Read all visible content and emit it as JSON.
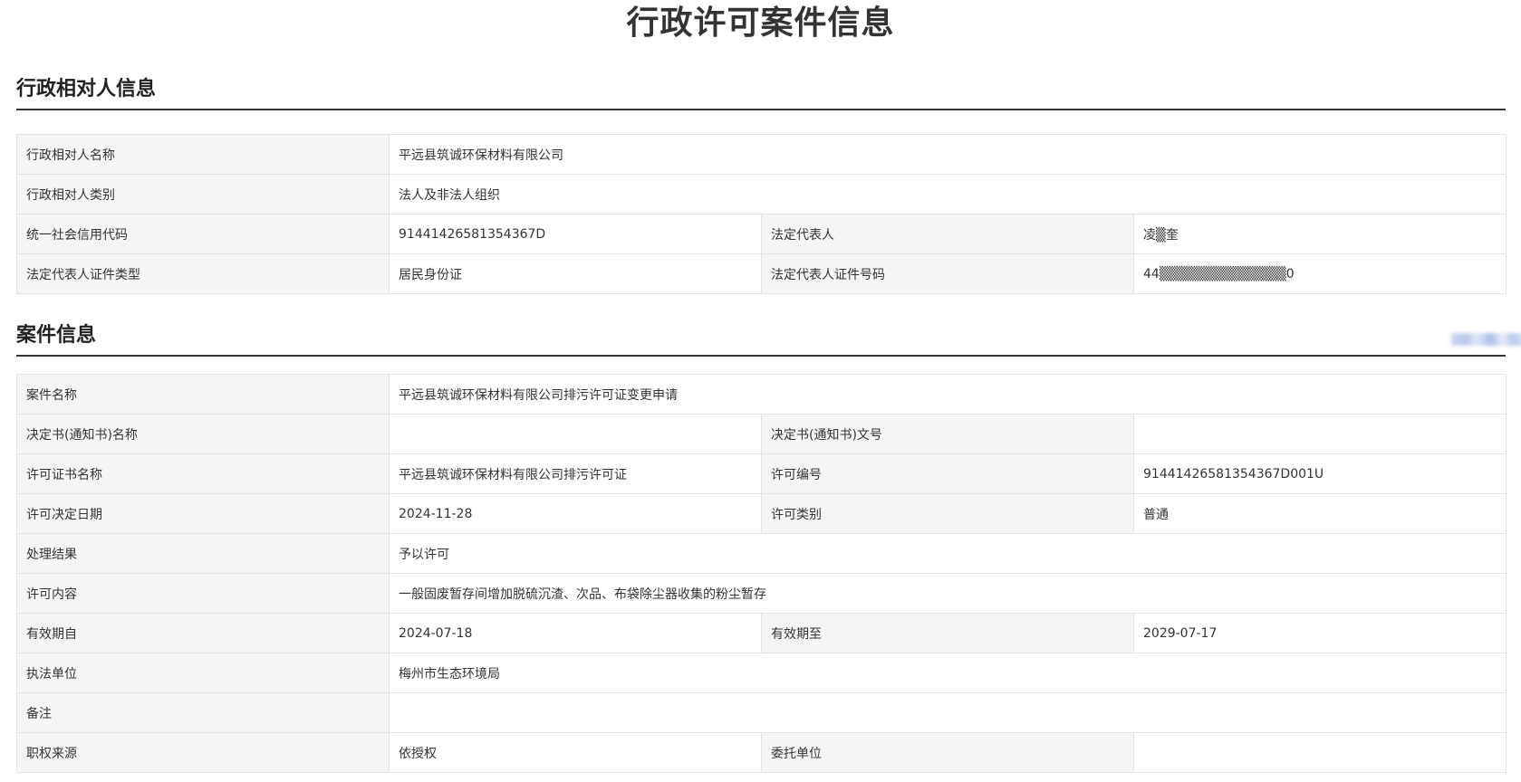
{
  "page_title": "行政许可案件信息",
  "section1": {
    "title": "行政相对人信息",
    "rows": [
      {
        "label": "行政相对人名称",
        "value": "平远县筑诚环保材料有限公司"
      },
      {
        "label": "行政相对人类别",
        "value": "法人及非法人组织"
      },
      {
        "label": "统一社会信用代码",
        "value": "91441426581354367D",
        "label2": "法定代表人",
        "value2": "凌▒奎"
      },
      {
        "label": "法定代表人证件类型",
        "value": "居民身份证",
        "label2": "法定代表人证件号码",
        "value2": "44▒▒▒▒▒▒▒▒▒▒▒▒▒0"
      }
    ]
  },
  "section2": {
    "title": "案件信息",
    "rows": [
      {
        "label": "案件名称",
        "value": "平远县筑诚环保材料有限公司排污许可证变更申请"
      },
      {
        "label": "决定书(通知书)名称",
        "value": "",
        "label2": "决定书(通知书)文号",
        "value2": ""
      },
      {
        "label": "许可证书名称",
        "value": "平远县筑诚环保材料有限公司排污许可证",
        "label2": "许可编号",
        "value2": "91441426581354367D001U"
      },
      {
        "label": "许可决定日期",
        "value": "2024-11-28",
        "label2": "许可类别",
        "value2": "普通"
      },
      {
        "label": "处理结果",
        "value": "予以许可"
      },
      {
        "label": "许可内容",
        "value": "一般固废暂存间增加脱硫沉渣、次品、布袋除尘器收集的粉尘暂存"
      },
      {
        "label": "有效期自",
        "value": "2024-07-18",
        "label2": "有效期至",
        "value2": "2029-07-17"
      },
      {
        "label": "执法单位",
        "value": "梅州市生态环境局"
      },
      {
        "label": "备注",
        "value": ""
      },
      {
        "label": "职权来源",
        "value": "依授权",
        "label2": "委托单位",
        "value2": ""
      }
    ]
  }
}
